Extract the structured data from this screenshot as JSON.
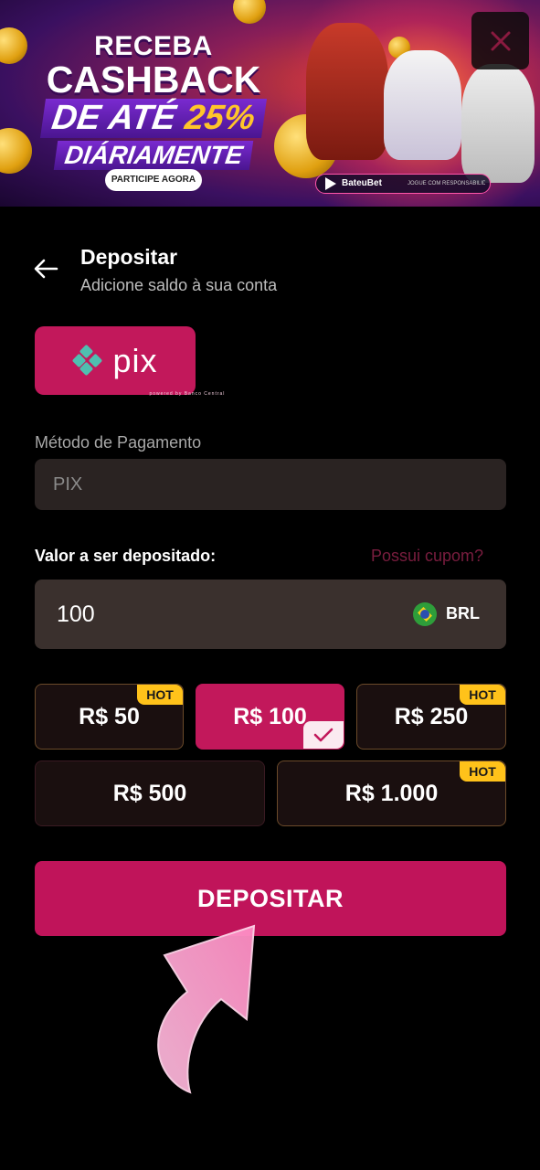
{
  "banner": {
    "line1": "RECEBA",
    "line2": "CASHBACK",
    "line3_prefix": "DE ATÉ",
    "line3_highlight": "25%",
    "line4": "DIÁRIAMENTE",
    "cta_label": "PARTICIPE AGORA",
    "brand": "BateuBet",
    "brand_note": "JOGUE COM RESPONSABILIDADE",
    "close_icon": "close-icon"
  },
  "header": {
    "title": "Depositar",
    "subtitle": "Adicione saldo à sua conta"
  },
  "payment_option": {
    "logo_text": "pix",
    "logo_caption": "powered by Banco Central"
  },
  "method": {
    "label": "Método de Pagamento",
    "value": "PIX"
  },
  "amount": {
    "label": "Valor a ser depositado:",
    "coupon_link": "Possui cupom?",
    "value": "100",
    "currency": "BRL"
  },
  "presets": [
    {
      "label": "R$ 50",
      "hot": "HOT",
      "selected": false
    },
    {
      "label": "R$ 100",
      "hot": "",
      "selected": true
    },
    {
      "label": "R$ 250",
      "hot": "HOT",
      "selected": false
    },
    {
      "label": "R$ 500",
      "hot": "",
      "selected": false
    },
    {
      "label": "R$ 1.000",
      "hot": "HOT",
      "selected": false
    }
  ],
  "submit_label": "DEPOSITAR",
  "colors": {
    "accent": "#c0145a",
    "hot_badge": "#ffc21a",
    "coupon_link": "#7a1d3f",
    "background": "#000000"
  }
}
